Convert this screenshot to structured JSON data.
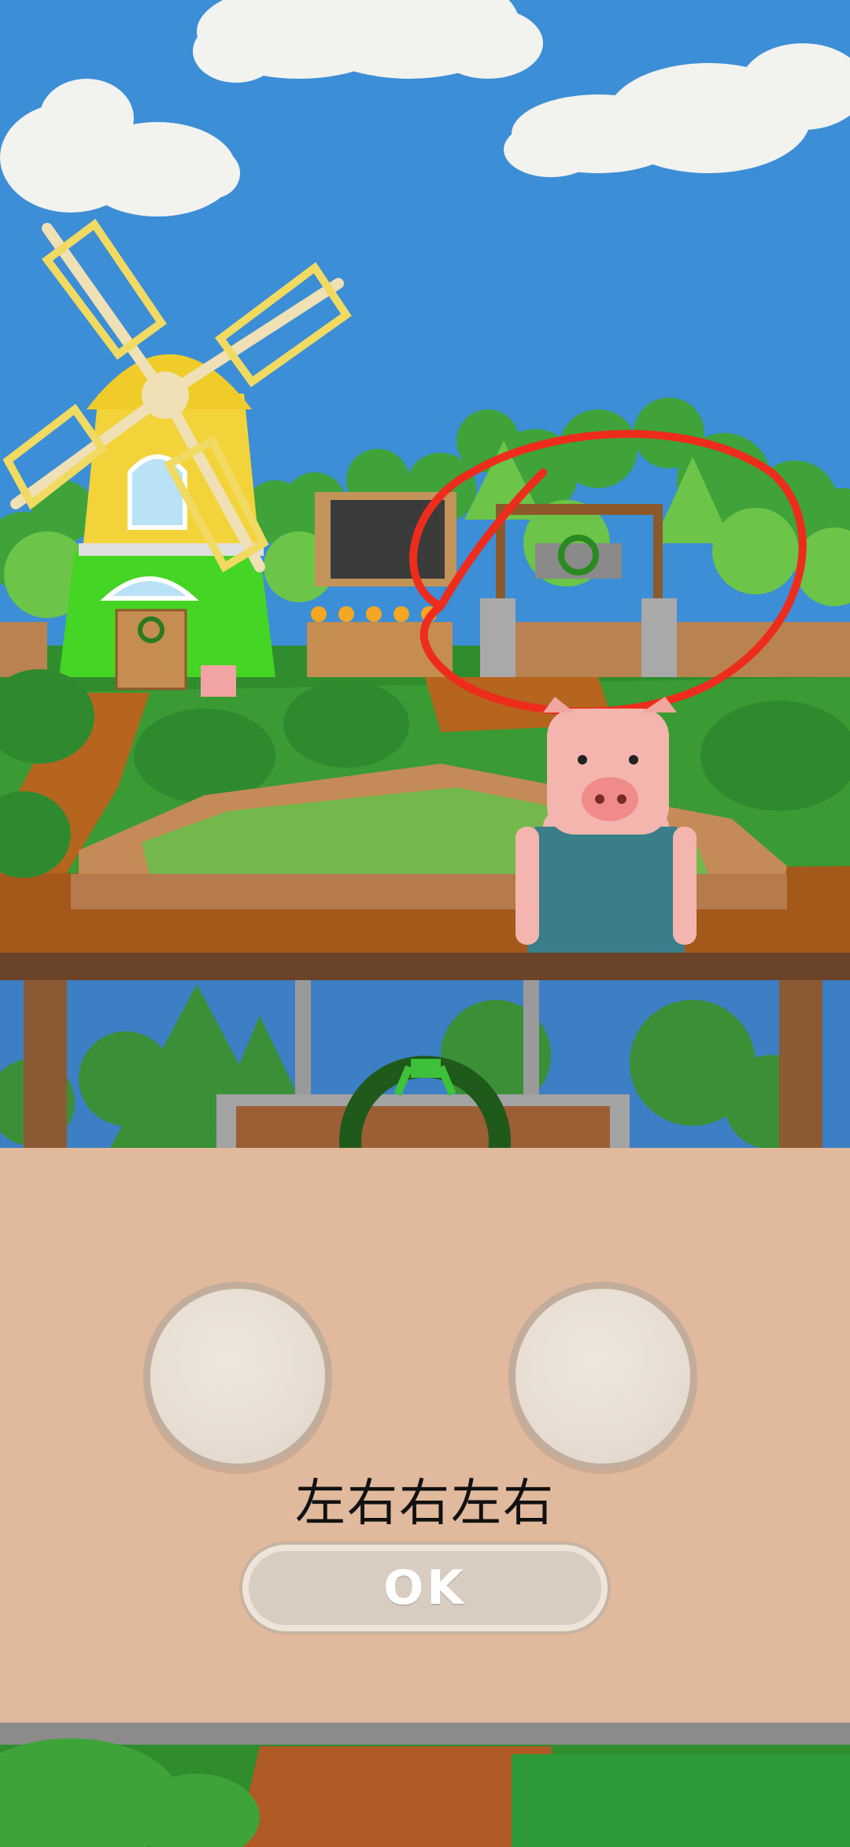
{
  "puzzle": {
    "hint_text": "左右右左右",
    "ok_label": "OK"
  },
  "scene": {
    "icons": [
      "windmill",
      "chalkboard",
      "hanging-wreath-sign",
      "pig-character",
      "wooden-gate",
      "red-circle-mark"
    ],
    "colors": {
      "sky": "#3c8ed6",
      "panel": "#e1b99c",
      "red_mark": "#ee2c1c",
      "windmill_yellow": "#f3d33a",
      "windmill_green": "#45d524"
    }
  }
}
